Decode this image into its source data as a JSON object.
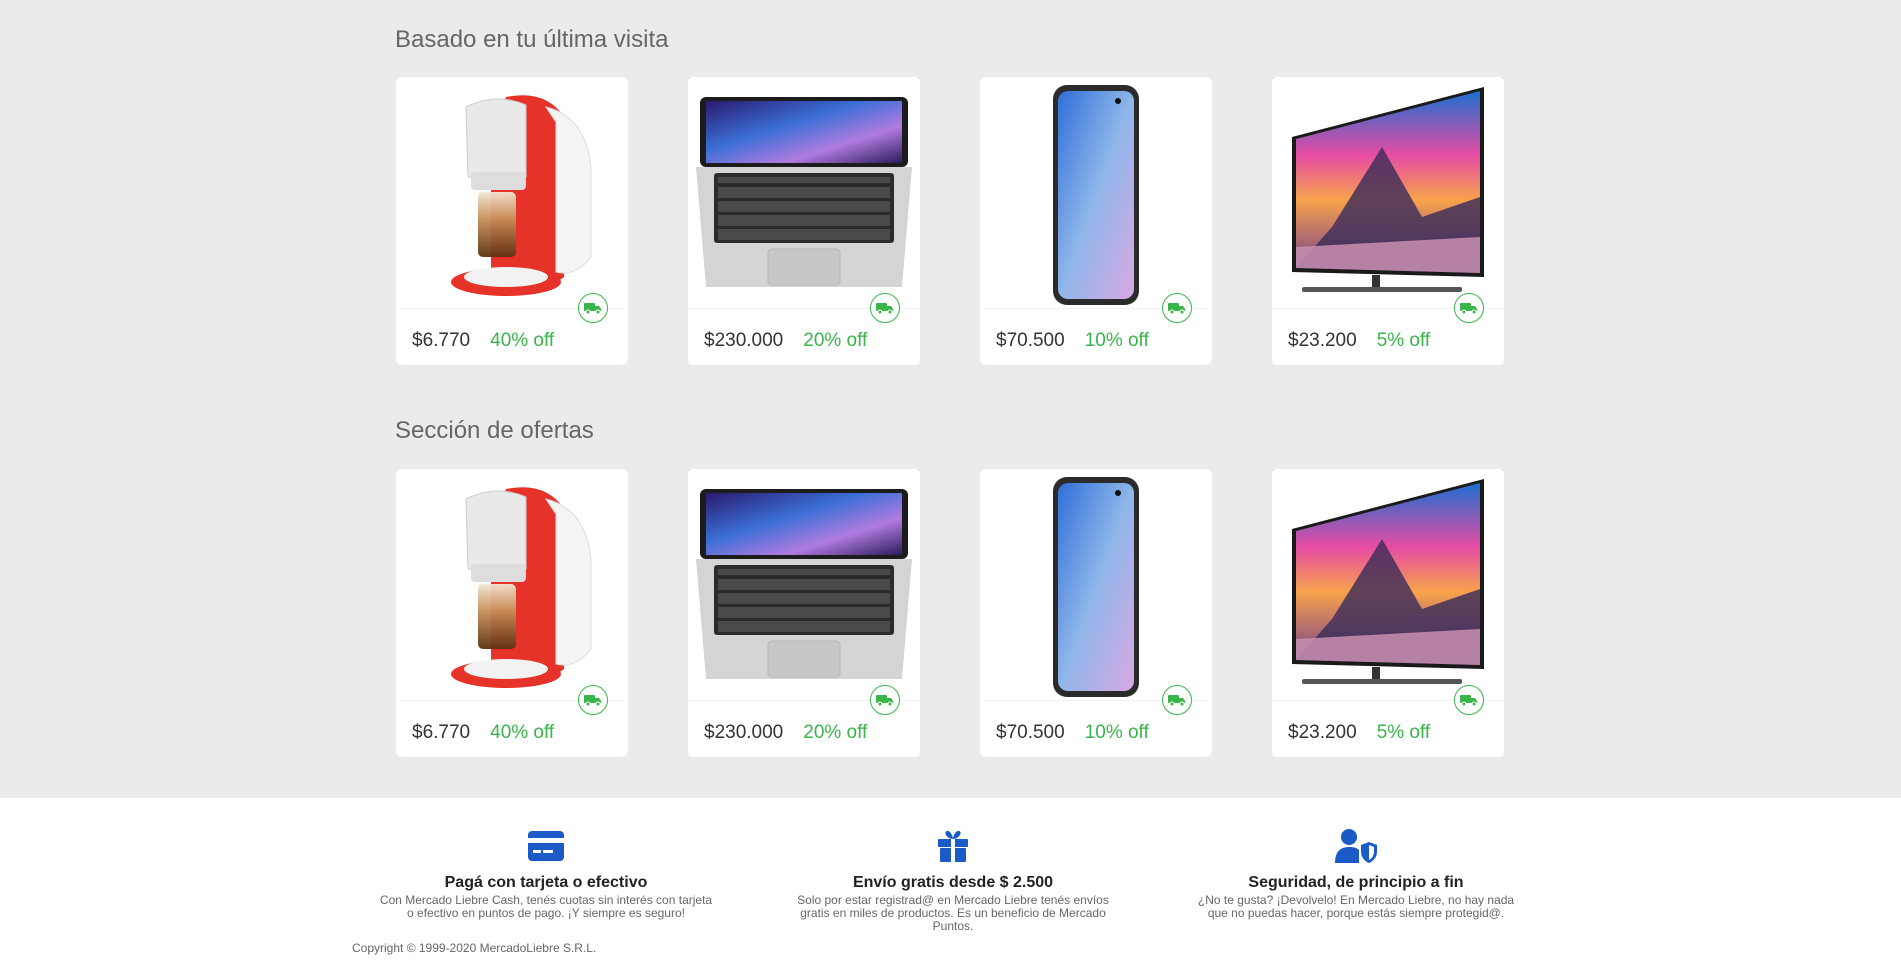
{
  "sections": [
    {
      "title": "Basado en tu última visita",
      "products": [
        {
          "image": "coffee-machine",
          "price": "$6.770",
          "discount": "40% off"
        },
        {
          "image": "laptop",
          "price": "$230.000",
          "discount": "20% off"
        },
        {
          "image": "smartphone",
          "price": "$70.500",
          "discount": "10% off"
        },
        {
          "image": "television",
          "price": "$23.200",
          "discount": "5% off"
        }
      ]
    },
    {
      "title": "Sección de ofertas",
      "products": [
        {
          "image": "coffee-machine",
          "price": "$6.770",
          "discount": "40% off"
        },
        {
          "image": "laptop",
          "price": "$230.000",
          "discount": "20% off"
        },
        {
          "image": "smartphone",
          "price": "$70.500",
          "discount": "10% off"
        },
        {
          "image": "television",
          "price": "$23.200",
          "discount": "5% off"
        }
      ]
    }
  ],
  "footer": {
    "features": [
      {
        "icon": "credit-card-icon",
        "title": "Pagá con tarjeta o efectivo",
        "text": "Con Mercado Liebre Cash, tenés cuotas sin interés con tarjeta o efectivo en puntos de pago. ¡Y siempre es seguro!"
      },
      {
        "icon": "gift-icon",
        "title": "Envío gratis desde $ 2.500",
        "text": "Solo por estar registrad@ en Mercado Liebre tenés envíos gratis en miles de productos. Es un beneficio de Mercado Puntos."
      },
      {
        "icon": "user-shield-icon",
        "title": "Seguridad, de principio a fin",
        "text": "¿No te gusta? ¡Devolvelo! En Mercado Liebre, no hay nada que no puedas hacer, porque estás siempre protegid@."
      }
    ],
    "copyright": "Copyright © 1999-2020 MercadoLiebre S.R.L."
  },
  "colors": {
    "accent_green": "#39b54a",
    "icon_blue": "#1c5ac7",
    "background": "#ebebeb"
  }
}
